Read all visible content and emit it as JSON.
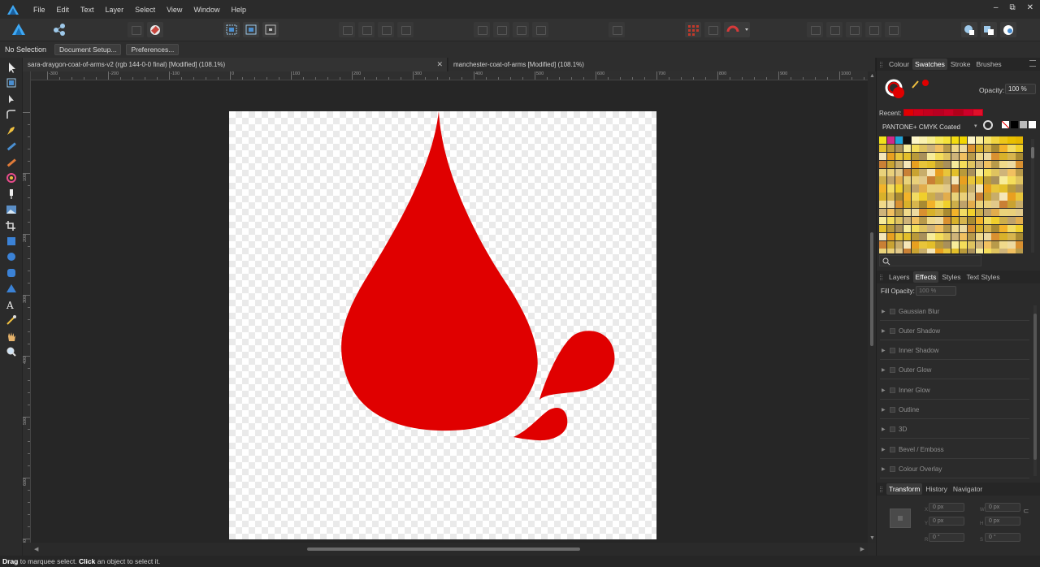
{
  "menu": [
    "File",
    "Edit",
    "Text",
    "Layer",
    "Select",
    "View",
    "Window",
    "Help"
  ],
  "context": {
    "selection": "No Selection",
    "document_setup": "Document Setup...",
    "preferences": "Preferences..."
  },
  "tabs": [
    {
      "title": "sara-draygon-coat-of-arms-v2 (rgb 144-0-0 final) [Modified] (108.1%)",
      "close": "✕"
    },
    {
      "title": "manchester-coat-of-arms [Modified] (108.1%)"
    }
  ],
  "ruler": {
    "h_labels": [
      "-300",
      "-200",
      "-100",
      "0",
      "100",
      "200",
      "300",
      "400",
      "500",
      "600",
      "700",
      "800",
      "900",
      "1000"
    ],
    "v_labels": [
      "100",
      "200",
      "300",
      "400",
      "500",
      "600",
      "700"
    ]
  },
  "right": {
    "swatch_tabs": [
      "Colour",
      "Swatches",
      "Stroke",
      "Brushes"
    ],
    "opacity_label": "Opacity:",
    "opacity_value": "100 %",
    "recent_label": "Recent:",
    "palette_name": "PANTONE+ CMYK Coated",
    "effects_tabs": [
      "Layers",
      "Effects",
      "Styles",
      "Text Styles"
    ],
    "fill_opacity_label": "Fill Opacity:",
    "fill_opacity_value": "100 %",
    "effects": [
      "Gaussian Blur",
      "Outer Shadow",
      "Inner Shadow",
      "Outer Glow",
      "Inner Glow",
      "Outline",
      "3D",
      "Bevel / Emboss",
      "Colour Overlay"
    ],
    "transform_tabs": [
      "Transform",
      "History",
      "Navigator"
    ],
    "transform": {
      "x": "0 px",
      "y": "0 px",
      "w": "0 px",
      "h": "0 px",
      "r": "0 °",
      "s": "0 °"
    }
  },
  "status": {
    "drag": "Drag",
    "drag_text": " to marquee select. ",
    "click": "Click",
    "click_text": " an object to select it."
  },
  "colors": {
    "drop_red": "#e00000",
    "accent_blue": "#1e90ff"
  }
}
